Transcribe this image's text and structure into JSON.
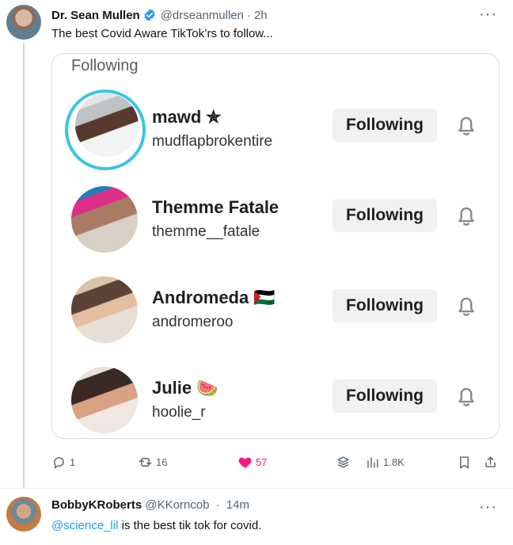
{
  "tweet": {
    "author_name": "Dr. Sean Mullen",
    "handle": "@drseanmullen",
    "separator": "·",
    "time": "2h",
    "more": "···",
    "text": "The best Covid Aware TikTok’rs to follow...",
    "icons": {
      "avatar": "profile-photo",
      "verified": "verified-badge-icon",
      "more": "more-options-icon"
    },
    "colors": {
      "verified": "#1d9bf0",
      "like": "#f91880",
      "muted": "#536471"
    }
  },
  "card": {
    "title": "Following",
    "profiles": [
      {
        "name": "mawd",
        "emoji": "✯",
        "handle": "mudflapbrokentire",
        "button": "Following",
        "story_ring": true
      },
      {
        "name": "Themme Fatale",
        "emoji": "",
        "handle": "themme__fatale",
        "button": "Following",
        "story_ring": false
      },
      {
        "name": "Andromeda",
        "emoji": "🇵🇸",
        "handle": "andromeroo",
        "button": "Following",
        "story_ring": false
      },
      {
        "name": "Julie",
        "emoji": "🍉",
        "handle": "hoolie_r",
        "button": "Following",
        "story_ring": false
      }
    ],
    "icons": {
      "bell": "bell-icon",
      "story_ring": "story-ring",
      "ring_color": "#38c6e4"
    }
  },
  "actions": {
    "reply_count": "1",
    "retweet_count": "16",
    "like_count": "57",
    "views_count": "1.8K",
    "icons": {
      "reply": "reply-icon",
      "retweet": "retweet-icon",
      "like": "heart-icon",
      "stack": "stack-icon",
      "views": "views-chart-icon",
      "bookmark": "bookmark-icon",
      "share": "share-icon"
    }
  },
  "reply": {
    "author_name": "BobbyKRoberts",
    "handle": "@KKorncob",
    "separator": "·",
    "time": "14m",
    "more": "···",
    "mention": "@science_lil",
    "text": " is the best tik tok for covid.",
    "icons": {
      "avatar": "profile-photo",
      "more": "more-options-icon"
    }
  }
}
